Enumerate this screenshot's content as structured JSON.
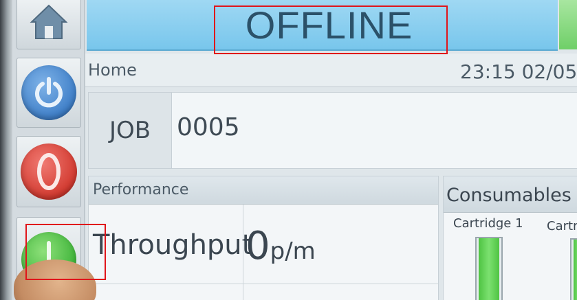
{
  "nav": {
    "home_icon": "home-icon",
    "power_icon": "power-icon",
    "stop_icon": "stop-icon",
    "start_icon": "start-icon"
  },
  "status": {
    "text": "OFFLINE"
  },
  "breadcrumb": {
    "label": "Home",
    "clock": "23:15 02/05"
  },
  "job": {
    "label": "JOB",
    "value": "0005"
  },
  "performance": {
    "title": "Performance",
    "throughput_label": "Throughput",
    "throughput_value": "0",
    "throughput_unit": "p/m"
  },
  "consumables": {
    "title": "Consumables",
    "cartridges": [
      {
        "label": "Cartridge 1",
        "level": 1.0
      },
      {
        "label": "Cartr",
        "level": 1.0
      }
    ]
  },
  "colors": {
    "status_banner": "#78c6ec",
    "highlight": "#e0141a",
    "cartridge_fill": "#4fc443"
  }
}
